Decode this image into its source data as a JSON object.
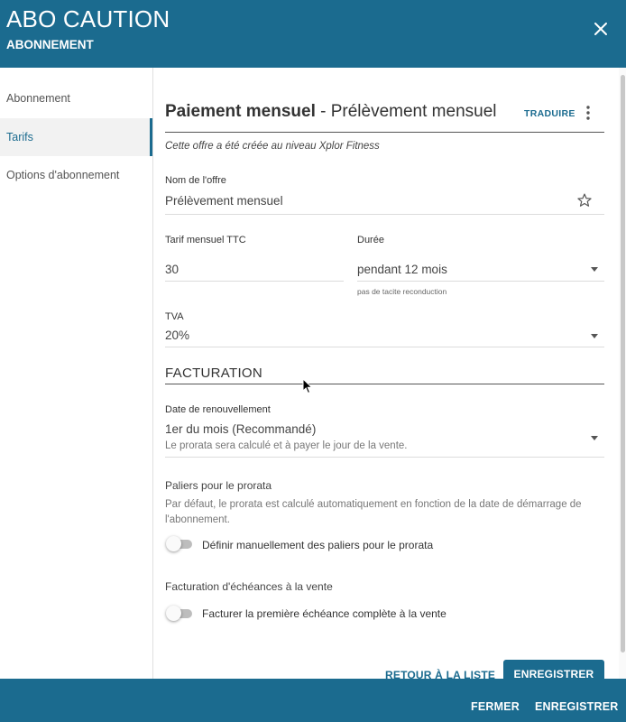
{
  "header": {
    "title": "ABO CAUTION",
    "subtitle": "ABONNEMENT",
    "close_icon": "close-icon"
  },
  "sidebar": {
    "items": [
      {
        "label": "Abonnement",
        "active": false
      },
      {
        "label": "Tarifs",
        "active": true
      },
      {
        "label": "Options d'abonnement",
        "active": false
      }
    ]
  },
  "offer": {
    "title_bold": "Paiement mensuel",
    "title_rest": " - Prélèvement mensuel",
    "translate_label": "TRADUIRE",
    "note": "Cette offre a été créée au niveau Xplor Fitness"
  },
  "fields": {
    "name_label": "Nom de l'offre",
    "name_value": "Prélèvement mensuel",
    "tarif_label": "Tarif mensuel TTC",
    "tarif_value": "30",
    "duree_label": "Durée",
    "duree_value": "pendant 12 mois",
    "duree_helper": "pas de tacite reconduction",
    "tva_label": "TVA",
    "tva_value": "20%"
  },
  "facturation": {
    "section_title": "FACTURATION",
    "renewal_label": "Date de renouvellement",
    "renewal_value": "1er du mois (Recommandé)",
    "renewal_hint": "Le prorata sera calculé et à payer le jour de la vente.",
    "prorata_title": "Paliers pour le prorata",
    "prorata_para": "Par défaut, le prorata est calculé automatiquement en fonction de la date de démarrage de l'abonnement.",
    "prorata_toggle_label": "Définir manuellement des paliers pour le prorata",
    "prorata_toggle_on": false,
    "echeance_title": "Facturation d'échéances à la vente",
    "echeance_toggle_label": "Facturer la première échéance complète à la vente",
    "echeance_toggle_on": false
  },
  "actions": {
    "back_label": "RETOUR À LA LISTE",
    "save_label": "ENREGISTRER"
  },
  "footer": {
    "close_label": "FERMER",
    "save_label": "ENREGISTRER"
  },
  "colors": {
    "brand": "#1b6b8f"
  }
}
